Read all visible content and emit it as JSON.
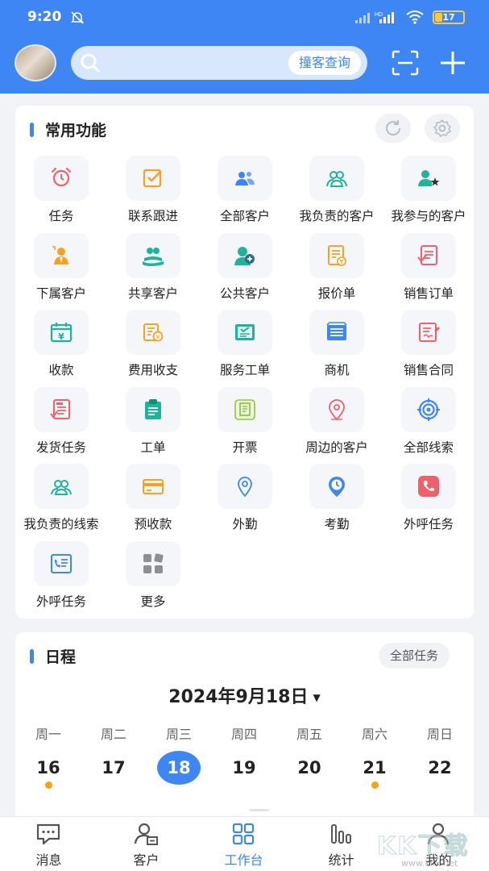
{
  "status_bar": {
    "time": "9:20",
    "battery": "17"
  },
  "search": {
    "button_label": "撞客查询"
  },
  "common": {
    "title": "常用功能",
    "items": [
      {
        "label": "任务",
        "icon": "alarm-clock-icon",
        "color": "#f0606a"
      },
      {
        "label": "联系跟进",
        "icon": "checkbox-icon",
        "color": "#f4a21f"
      },
      {
        "label": "全部客户",
        "icon": "users-icon",
        "color": "#3d86f3"
      },
      {
        "label": "我负责的客户",
        "icon": "users-outline-icon",
        "color": "#1fb39a"
      },
      {
        "label": "我参与的客户",
        "icon": "user-star-icon",
        "color": "#1fb39a"
      },
      {
        "label": "下属客户",
        "icon": "subordinate-icon",
        "color": "#f4a21f"
      },
      {
        "label": "共享客户",
        "icon": "share-hand-icon",
        "color": "#1fb39a"
      },
      {
        "label": "公共客户",
        "icon": "public-users-icon",
        "color": "#1fb39a"
      },
      {
        "label": "报价单",
        "icon": "quote-doc-icon",
        "color": "#f4a21f"
      },
      {
        "label": "销售订单",
        "icon": "order-doc-icon",
        "color": "#f0606a"
      },
      {
        "label": "收款",
        "icon": "calendar-yuan-icon",
        "color": "#1fb39a"
      },
      {
        "label": "费用收支",
        "icon": "expense-icon",
        "color": "#f4a21f"
      },
      {
        "label": "服务工单",
        "icon": "service-ticket-icon",
        "color": "#1fb39a"
      },
      {
        "label": "商机",
        "icon": "newspaper-icon",
        "color": "#3d86f3"
      },
      {
        "label": "销售合同",
        "icon": "contract-icon",
        "color": "#f0606a"
      },
      {
        "label": "发货任务",
        "icon": "delivery-doc-icon",
        "color": "#f0606a"
      },
      {
        "label": "工单",
        "icon": "clipboard-icon",
        "color": "#1fb39a"
      },
      {
        "label": "开票",
        "icon": "invoice-icon",
        "color": "#8ec63f"
      },
      {
        "label": "周边的客户",
        "icon": "location-pin-icon",
        "color": "#f0606a"
      },
      {
        "label": "全部线索",
        "icon": "target-icon",
        "color": "#3d86f3"
      },
      {
        "label": "我负责的线索",
        "icon": "leads-users-icon",
        "color": "#1fb39a"
      },
      {
        "label": "预收款",
        "icon": "card-icon",
        "color": "#f4a21f"
      },
      {
        "label": "外勤",
        "icon": "map-pin-icon",
        "color": "#3d86f3"
      },
      {
        "label": "考勤",
        "icon": "clock-pin-icon",
        "color": "#3d86f3"
      },
      {
        "label": "外呼任务",
        "icon": "phone-icon",
        "color": "#f0606a"
      },
      {
        "label": "外呼任务",
        "icon": "phone-list-icon",
        "color": "#3d86f3"
      },
      {
        "label": "更多",
        "icon": "more-grid-icon",
        "color": "#888888"
      }
    ]
  },
  "schedule": {
    "title": "日程",
    "all_tasks": "全部任务",
    "month": "2024年9月18日",
    "weekdays": [
      "周一",
      "周二",
      "周三",
      "周四",
      "周五",
      "周六",
      "周日"
    ],
    "days": [
      "16",
      "17",
      "18",
      "19",
      "20",
      "21",
      "22"
    ],
    "selected_index": 2,
    "dots": [
      0,
      5
    ]
  },
  "nav": [
    {
      "label": "消息",
      "icon": "message-icon"
    },
    {
      "label": "客户",
      "icon": "customer-icon"
    },
    {
      "label": "工作台",
      "icon": "workbench-icon",
      "active": true
    },
    {
      "label": "统计",
      "icon": "stats-icon"
    },
    {
      "label": "我的",
      "icon": "profile-icon"
    }
  ],
  "watermark": {
    "text": "KK下载",
    "url": "www.kkx.net"
  },
  "colors": {
    "primary": "#3d86f3",
    "dot": "#f4a21f"
  }
}
